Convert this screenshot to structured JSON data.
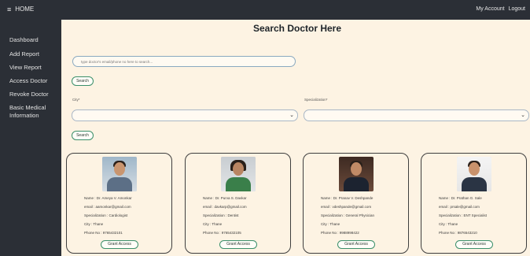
{
  "topbar": {
    "brand_icon": "hamburger-menu-icon",
    "brand_label": "HOME",
    "account_label": "My Account",
    "logout_label": "Logout"
  },
  "sidebar": {
    "items": [
      {
        "label": "Dashboard"
      },
      {
        "label": "Add Report"
      },
      {
        "label": "View Report"
      },
      {
        "label": "Access Doctor"
      },
      {
        "label": "Revoke Doctor"
      },
      {
        "label": "Basic Medical\nInformation"
      }
    ]
  },
  "main": {
    "title": "Search Doctor Here",
    "search_placeholder": "type doctor's email/phone no here to search...",
    "search_button": "Search",
    "city_label": "City*",
    "specialization_label": "Specialization*",
    "city_value": "",
    "specialization_value": "",
    "filter_button": "Search"
  },
  "doctors": [
    {
      "name": "Name : Dr. Ameya V. Amonkar",
      "email": "email : aamonkar@gmail.com",
      "specialization": "Specialization : Cardiologist",
      "city": "City : Thane",
      "phone": "Phone No : 9765432101",
      "grant_label": "Grant Access"
    },
    {
      "name": "Name : Dr. Purva S. Davkar",
      "email": "email : davkarp@gmail.com",
      "specialization": "Specialization : Dentist",
      "city": "City : Thane",
      "phone": "Phone No : 9765432105",
      "grant_label": "Grant Access"
    },
    {
      "name": "Name : Dr. Pranav V. Deshpande",
      "email": "email : vdeshpande@gmail.com",
      "specialization": "Specialization : General Physician",
      "city": "City : Thane",
      "phone": "Phone No : 9988998422",
      "grant_label": "Grant Access"
    },
    {
      "name": "Name : Dr. Prathan G. Sale",
      "email": "email : prsale@gmail.com",
      "specialization": "Specialization : ENT Specialist",
      "city": "City : Thane",
      "phone": "Phone No : 9876543210",
      "grant_label": "Grant Access"
    }
  ],
  "colors": {
    "sidebar_bg": "#2b2f36",
    "page_bg": "#fdf3e3",
    "button_border": "#3a8f6a"
  }
}
